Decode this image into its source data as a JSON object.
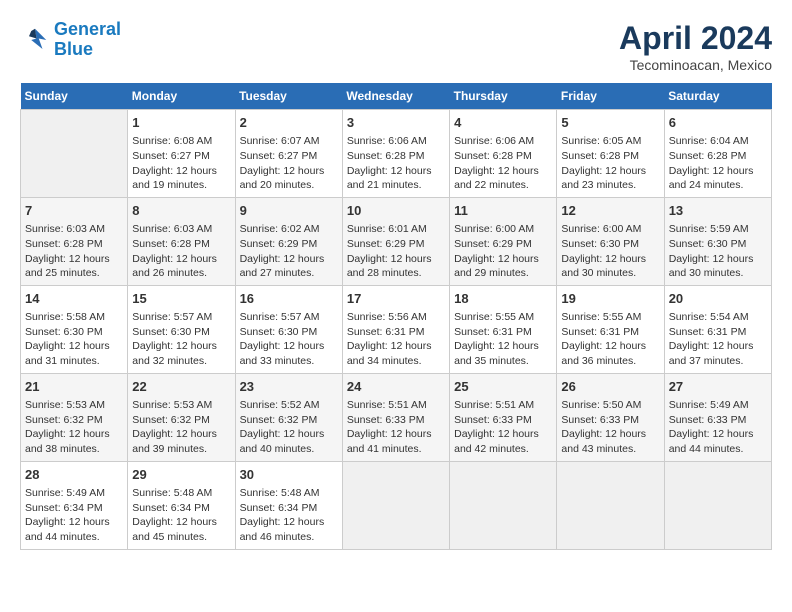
{
  "header": {
    "logo_line1": "General",
    "logo_line2": "Blue",
    "month": "April 2024",
    "location": "Tecominoacan, Mexico"
  },
  "weekdays": [
    "Sunday",
    "Monday",
    "Tuesday",
    "Wednesday",
    "Thursday",
    "Friday",
    "Saturday"
  ],
  "weeks": [
    [
      {
        "day": "",
        "sunrise": "",
        "sunset": "",
        "daylight": ""
      },
      {
        "day": "1",
        "sunrise": "Sunrise: 6:08 AM",
        "sunset": "Sunset: 6:27 PM",
        "daylight": "Daylight: 12 hours and 19 minutes."
      },
      {
        "day": "2",
        "sunrise": "Sunrise: 6:07 AM",
        "sunset": "Sunset: 6:27 PM",
        "daylight": "Daylight: 12 hours and 20 minutes."
      },
      {
        "day": "3",
        "sunrise": "Sunrise: 6:06 AM",
        "sunset": "Sunset: 6:28 PM",
        "daylight": "Daylight: 12 hours and 21 minutes."
      },
      {
        "day": "4",
        "sunrise": "Sunrise: 6:06 AM",
        "sunset": "Sunset: 6:28 PM",
        "daylight": "Daylight: 12 hours and 22 minutes."
      },
      {
        "day": "5",
        "sunrise": "Sunrise: 6:05 AM",
        "sunset": "Sunset: 6:28 PM",
        "daylight": "Daylight: 12 hours and 23 minutes."
      },
      {
        "day": "6",
        "sunrise": "Sunrise: 6:04 AM",
        "sunset": "Sunset: 6:28 PM",
        "daylight": "Daylight: 12 hours and 24 minutes."
      }
    ],
    [
      {
        "day": "7",
        "sunrise": "Sunrise: 6:03 AM",
        "sunset": "Sunset: 6:28 PM",
        "daylight": "Daylight: 12 hours and 25 minutes."
      },
      {
        "day": "8",
        "sunrise": "Sunrise: 6:03 AM",
        "sunset": "Sunset: 6:28 PM",
        "daylight": "Daylight: 12 hours and 26 minutes."
      },
      {
        "day": "9",
        "sunrise": "Sunrise: 6:02 AM",
        "sunset": "Sunset: 6:29 PM",
        "daylight": "Daylight: 12 hours and 27 minutes."
      },
      {
        "day": "10",
        "sunrise": "Sunrise: 6:01 AM",
        "sunset": "Sunset: 6:29 PM",
        "daylight": "Daylight: 12 hours and 28 minutes."
      },
      {
        "day": "11",
        "sunrise": "Sunrise: 6:00 AM",
        "sunset": "Sunset: 6:29 PM",
        "daylight": "Daylight: 12 hours and 29 minutes."
      },
      {
        "day": "12",
        "sunrise": "Sunrise: 6:00 AM",
        "sunset": "Sunset: 6:30 PM",
        "daylight": "Daylight: 12 hours and 30 minutes."
      },
      {
        "day": "13",
        "sunrise": "Sunrise: 5:59 AM",
        "sunset": "Sunset: 6:30 PM",
        "daylight": "Daylight: 12 hours and 30 minutes."
      }
    ],
    [
      {
        "day": "14",
        "sunrise": "Sunrise: 5:58 AM",
        "sunset": "Sunset: 6:30 PM",
        "daylight": "Daylight: 12 hours and 31 minutes."
      },
      {
        "day": "15",
        "sunrise": "Sunrise: 5:57 AM",
        "sunset": "Sunset: 6:30 PM",
        "daylight": "Daylight: 12 hours and 32 minutes."
      },
      {
        "day": "16",
        "sunrise": "Sunrise: 5:57 AM",
        "sunset": "Sunset: 6:30 PM",
        "daylight": "Daylight: 12 hours and 33 minutes."
      },
      {
        "day": "17",
        "sunrise": "Sunrise: 5:56 AM",
        "sunset": "Sunset: 6:31 PM",
        "daylight": "Daylight: 12 hours and 34 minutes."
      },
      {
        "day": "18",
        "sunrise": "Sunrise: 5:55 AM",
        "sunset": "Sunset: 6:31 PM",
        "daylight": "Daylight: 12 hours and 35 minutes."
      },
      {
        "day": "19",
        "sunrise": "Sunrise: 5:55 AM",
        "sunset": "Sunset: 6:31 PM",
        "daylight": "Daylight: 12 hours and 36 minutes."
      },
      {
        "day": "20",
        "sunrise": "Sunrise: 5:54 AM",
        "sunset": "Sunset: 6:31 PM",
        "daylight": "Daylight: 12 hours and 37 minutes."
      }
    ],
    [
      {
        "day": "21",
        "sunrise": "Sunrise: 5:53 AM",
        "sunset": "Sunset: 6:32 PM",
        "daylight": "Daylight: 12 hours and 38 minutes."
      },
      {
        "day": "22",
        "sunrise": "Sunrise: 5:53 AM",
        "sunset": "Sunset: 6:32 PM",
        "daylight": "Daylight: 12 hours and 39 minutes."
      },
      {
        "day": "23",
        "sunrise": "Sunrise: 5:52 AM",
        "sunset": "Sunset: 6:32 PM",
        "daylight": "Daylight: 12 hours and 40 minutes."
      },
      {
        "day": "24",
        "sunrise": "Sunrise: 5:51 AM",
        "sunset": "Sunset: 6:33 PM",
        "daylight": "Daylight: 12 hours and 41 minutes."
      },
      {
        "day": "25",
        "sunrise": "Sunrise: 5:51 AM",
        "sunset": "Sunset: 6:33 PM",
        "daylight": "Daylight: 12 hours and 42 minutes."
      },
      {
        "day": "26",
        "sunrise": "Sunrise: 5:50 AM",
        "sunset": "Sunset: 6:33 PM",
        "daylight": "Daylight: 12 hours and 43 minutes."
      },
      {
        "day": "27",
        "sunrise": "Sunrise: 5:49 AM",
        "sunset": "Sunset: 6:33 PM",
        "daylight": "Daylight: 12 hours and 44 minutes."
      }
    ],
    [
      {
        "day": "28",
        "sunrise": "Sunrise: 5:49 AM",
        "sunset": "Sunset: 6:34 PM",
        "daylight": "Daylight: 12 hours and 44 minutes."
      },
      {
        "day": "29",
        "sunrise": "Sunrise: 5:48 AM",
        "sunset": "Sunset: 6:34 PM",
        "daylight": "Daylight: 12 hours and 45 minutes."
      },
      {
        "day": "30",
        "sunrise": "Sunrise: 5:48 AM",
        "sunset": "Sunset: 6:34 PM",
        "daylight": "Daylight: 12 hours and 46 minutes."
      },
      {
        "day": "",
        "sunrise": "",
        "sunset": "",
        "daylight": ""
      },
      {
        "day": "",
        "sunrise": "",
        "sunset": "",
        "daylight": ""
      },
      {
        "day": "",
        "sunrise": "",
        "sunset": "",
        "daylight": ""
      },
      {
        "day": "",
        "sunrise": "",
        "sunset": "",
        "daylight": ""
      }
    ]
  ]
}
